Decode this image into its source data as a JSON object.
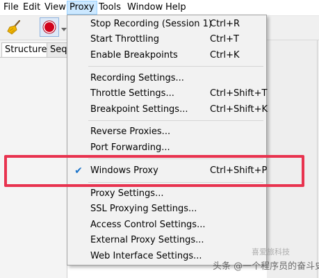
{
  "menubar": {
    "items": [
      {
        "label": "File"
      },
      {
        "label": "Edit"
      },
      {
        "label": "View"
      },
      {
        "label": "Proxy"
      },
      {
        "label": "Tools"
      },
      {
        "label": "Window"
      },
      {
        "label": "Help"
      }
    ],
    "active": "Proxy"
  },
  "toolbar": {
    "buttons": [
      "broom-icon",
      "record-icon",
      "dropdown-arrow-icon"
    ]
  },
  "leftpane": {
    "tabs": [
      "Structure",
      "Seq"
    ]
  },
  "proxy_menu": {
    "groups": [
      [
        {
          "label": "Stop Recording (Session 1)",
          "shortcut": "Ctrl+R"
        },
        {
          "label": "Start Throttling",
          "shortcut": "Ctrl+T"
        },
        {
          "label": "Enable Breakpoints",
          "shortcut": "Ctrl+K"
        }
      ],
      [
        {
          "label": "Recording Settings...",
          "shortcut": ""
        },
        {
          "label": "Throttle Settings...",
          "shortcut": "Ctrl+Shift+T"
        },
        {
          "label": "Breakpoint Settings...",
          "shortcut": "Ctrl+Shift+K"
        }
      ],
      [
        {
          "label": "Reverse Proxies...",
          "shortcut": ""
        },
        {
          "label": "Port Forwarding...",
          "shortcut": ""
        }
      ],
      [
        {
          "label": "Windows Proxy",
          "shortcut": "Ctrl+Shift+P",
          "checked": true
        }
      ],
      [
        {
          "label": "Proxy Settings...",
          "shortcut": ""
        },
        {
          "label": "SSL Proxying Settings...",
          "shortcut": ""
        },
        {
          "label": "Access Control Settings...",
          "shortcut": ""
        },
        {
          "label": "External Proxy Settings...",
          "shortcut": ""
        },
        {
          "label": "Web Interface Settings...",
          "shortcut": ""
        }
      ]
    ]
  },
  "watermark": {
    "text": "头条 @一个程序员的奋斗史",
    "logo_text": "喜爱旅科技"
  },
  "colors": {
    "highlight": "#e8334f",
    "menu_active_bg": "#cce8ff",
    "check": "#1a73c9",
    "record": "#d0021b"
  }
}
